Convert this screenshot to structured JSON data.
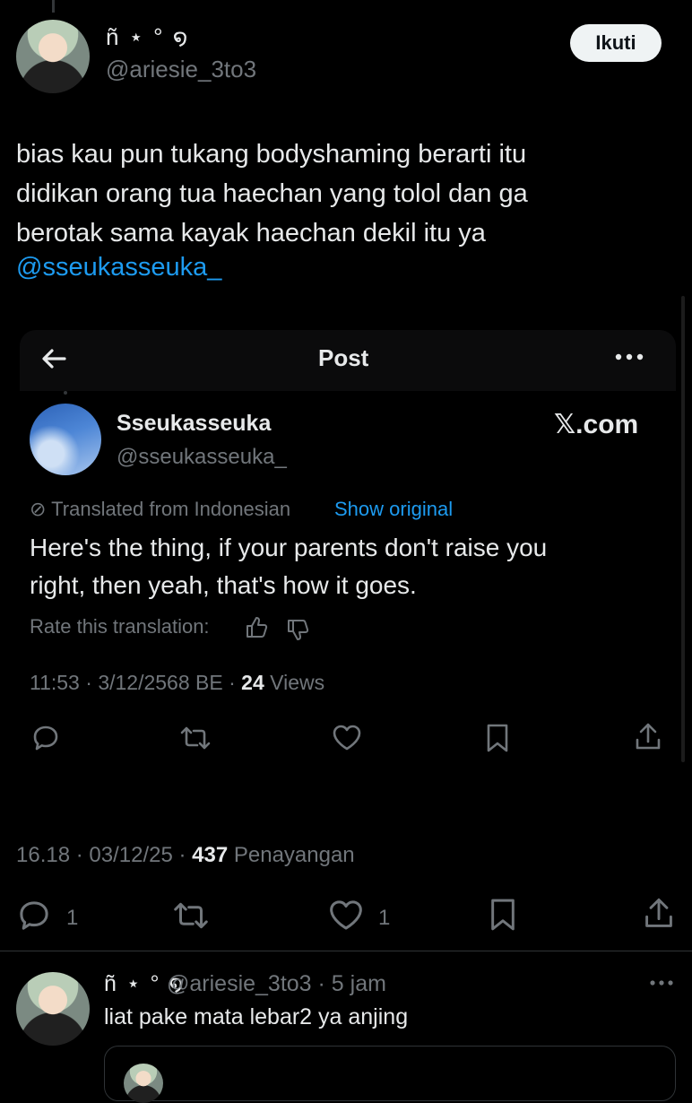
{
  "main_tweet": {
    "display_name": "ñ  ⋆ ° ໑",
    "handle": "@ariesie_3to3",
    "follow_label": "Ikuti",
    "text": "bias kau pun tukang bodyshaming berarti itu\ndidikan orang tua haechan yang tolol dan ga\nberotak sama kayak haechan dekil itu ya",
    "mention": "@sseukasseuka_",
    "time": "16.18",
    "date": "03/12/25",
    "views": "437",
    "views_label": "Penayangan",
    "reply_count": "1",
    "like_count": "1"
  },
  "embedded_post": {
    "header_title": "Post",
    "display_name": "Sseukasseuka",
    "handle": "@sseukasseuka_",
    "brand": "𝕏.com",
    "translated_label": "Translated from Indonesian",
    "show_original_label": "Show original",
    "text": "Here's the thing, if your parents don't raise you\nright, then yeah, that's how it goes.",
    "rate_label": "Rate this translation:",
    "time": "11:53",
    "date": "3/12/2568 BE",
    "views": "24",
    "views_label": "Views"
  },
  "reply": {
    "display_name": "ñ  ⋆ ° ໑",
    "handle": "@ariesie_3to3 · 5 jam",
    "text": "liat pake mata lebar2 ya anjing"
  },
  "icons": [
    "back-arrow-icon",
    "more-icon",
    "translate-icon",
    "thumbs-up-icon",
    "thumbs-down-icon",
    "reply-icon",
    "retweet-icon",
    "like-icon",
    "bookmark-icon",
    "share-icon"
  ]
}
